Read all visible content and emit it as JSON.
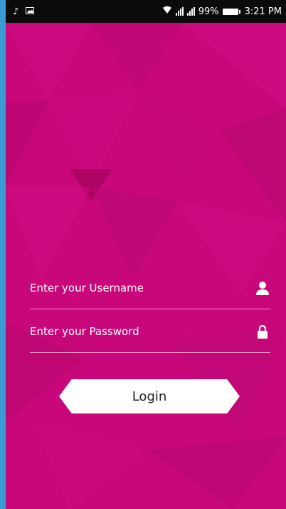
{
  "status_bar": {
    "battery_percent": "99%",
    "time": "3:21 PM",
    "icons": [
      "music-note-icon",
      "image-icon",
      "wifi-icon",
      "signal-icon",
      "signal-icon",
      "battery-icon"
    ]
  },
  "login_form": {
    "username_placeholder": "Enter your Username",
    "username_value": "",
    "username_icon": "user-icon",
    "password_placeholder": "Enter your Password",
    "password_value": "",
    "password_icon": "lock-icon",
    "login_label": "Login"
  },
  "colors": {
    "background": "#c8087a",
    "status_bar": "#0b0b0b",
    "button": "#ffffff",
    "outer_frame": "#3a9ad4"
  }
}
